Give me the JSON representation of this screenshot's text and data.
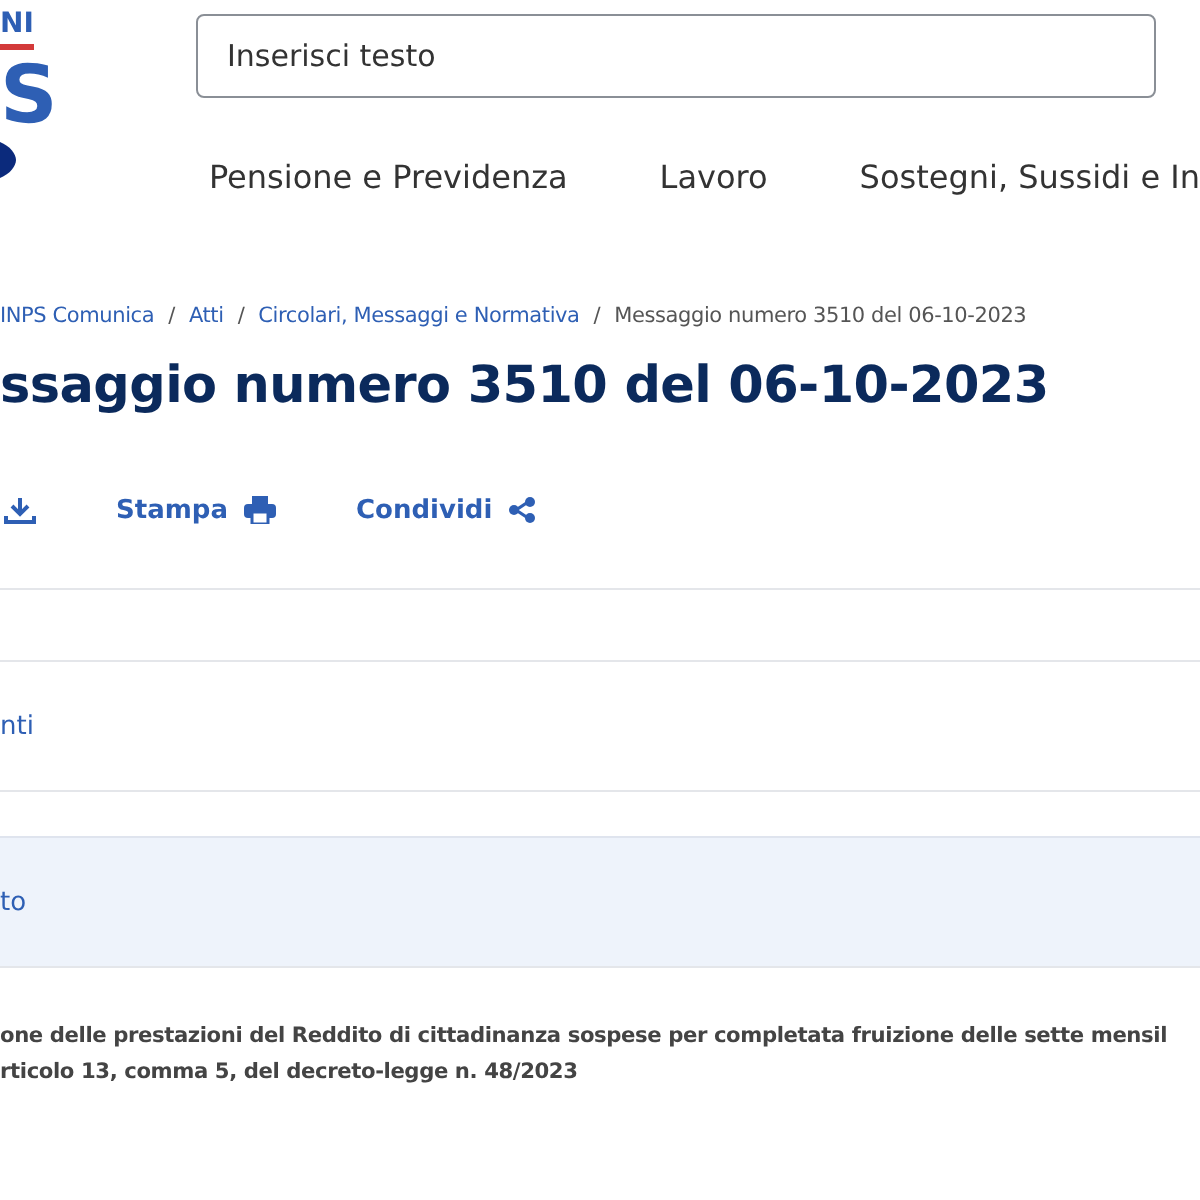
{
  "logo": {
    "top": "NI",
    "main": "S"
  },
  "search": {
    "placeholder": "Inserisci testo"
  },
  "nav": [
    "Pensione e Previdenza",
    "Lavoro",
    "Sostegni, Sussidi e In"
  ],
  "breadcrumb": [
    {
      "kind": "link",
      "label": "INPS Comunica"
    },
    {
      "kind": "separator",
      "label": "/"
    },
    {
      "kind": "link",
      "label": "Atti"
    },
    {
      "kind": "separator",
      "label": "/"
    },
    {
      "kind": "link",
      "label": "Circolari, Messaggi e Normativa"
    },
    {
      "kind": "separator",
      "label": "/"
    },
    {
      "kind": "current",
      "label": "Messaggio numero 3510 del 06-10-2023"
    }
  ],
  "title": "ssaggio numero 3510 del 06-10-2023",
  "actions": [
    {
      "kind": "download"
    },
    {
      "kind": "print",
      "label": "Stampa"
    },
    {
      "kind": "share",
      "label": "Condividi"
    }
  ],
  "sections": [
    {
      "selected": false
    },
    {
      "label": "nti",
      "selected": false
    },
    {
      "label": "to",
      "selected": true
    }
  ],
  "body": [
    "one delle prestazioni del Reddito di cittadinanza sospese per completata fruizione delle sette mensil",
    "rticolo 13, comma 5, del decreto-legge n. 48/2023"
  ]
}
